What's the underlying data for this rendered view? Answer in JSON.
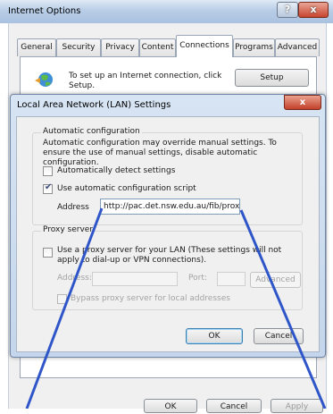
{
  "io": {
    "title": "Internet Options",
    "help_glyph": "?",
    "close_glyph": "x",
    "tabs": [
      "General",
      "Security",
      "Privacy",
      "Content",
      "Connections",
      "Programs",
      "Advanced"
    ],
    "active_tab": "Connections",
    "setup_text": "To set up an Internet connection, click Setup.",
    "setup_button": "Setup",
    "ok": "OK",
    "cancel": "Cancel",
    "apply": "Apply"
  },
  "lan": {
    "title": "Local Area Network (LAN) Settings",
    "close_glyph": "x",
    "auto": {
      "legend": "Automatic configuration",
      "description": "Automatic configuration may override manual settings.  To ensure the use of manual settings, disable automatic configuration.",
      "detect_label": "Automatically detect settings",
      "detect_checked": false,
      "script_label": "Use automatic configuration script",
      "script_checked": true,
      "address_label": "Address",
      "address_value": "http://pac.det.nsw.edu.au/fib/proxy"
    },
    "proxy": {
      "legend": "Proxy server",
      "use_label": "Use a proxy server for your LAN (These settings will not apply to dial-up or VPN connections).",
      "use_checked": false,
      "address_label": "Address:",
      "port_label": "Port:",
      "advanced": "Advanced",
      "bypass_label": "Bypass proxy server for local addresses"
    },
    "ok": "OK",
    "cancel": "Cancel"
  },
  "colors": {
    "annotation_line": "#2f56c9",
    "dialog_frame": "#c5d6ec",
    "close_red": "#c2402a"
  }
}
